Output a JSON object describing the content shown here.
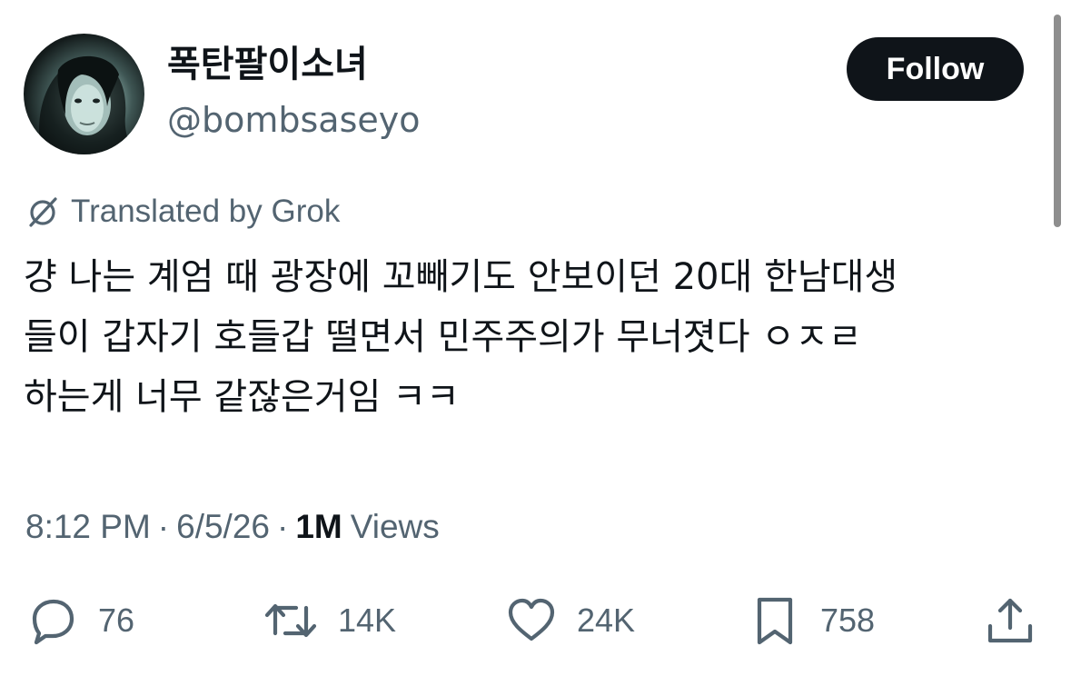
{
  "author": {
    "display_name": "폭탄팔이소녀",
    "handle": "@bombsaseyo",
    "avatar_icon": "profile-photo"
  },
  "follow_button": {
    "label": "Follow"
  },
  "translation": {
    "icon": "grok-icon",
    "label": "Translated by Grok"
  },
  "tweet": {
    "text": "걍 나는 계엄 때 광장에 꼬빼기도 안보이던 20대 한남대생\n들이 갑자기 호들갑 떨면서 민주주의가 무너졋다 ㅇㅈㄹ\n하는게 너무 같잖은거임 ㅋㅋ"
  },
  "meta": {
    "time": "8:12 PM",
    "separator": "·",
    "date": "6/5/26",
    "views_count": "1M",
    "views_label": "Views"
  },
  "actions": {
    "reply": {
      "icon": "reply-icon",
      "count": "76"
    },
    "retweet": {
      "icon": "retweet-icon",
      "count": "14K"
    },
    "like": {
      "icon": "heart-icon",
      "count": "24K"
    },
    "bookmark": {
      "icon": "bookmark-icon",
      "count": "758"
    },
    "share": {
      "icon": "share-icon"
    }
  },
  "colors": {
    "primary_text": "#0f1419",
    "secondary_text": "#536471",
    "button_bg": "#0f1419",
    "button_text": "#ffffff",
    "background": "#ffffff"
  }
}
